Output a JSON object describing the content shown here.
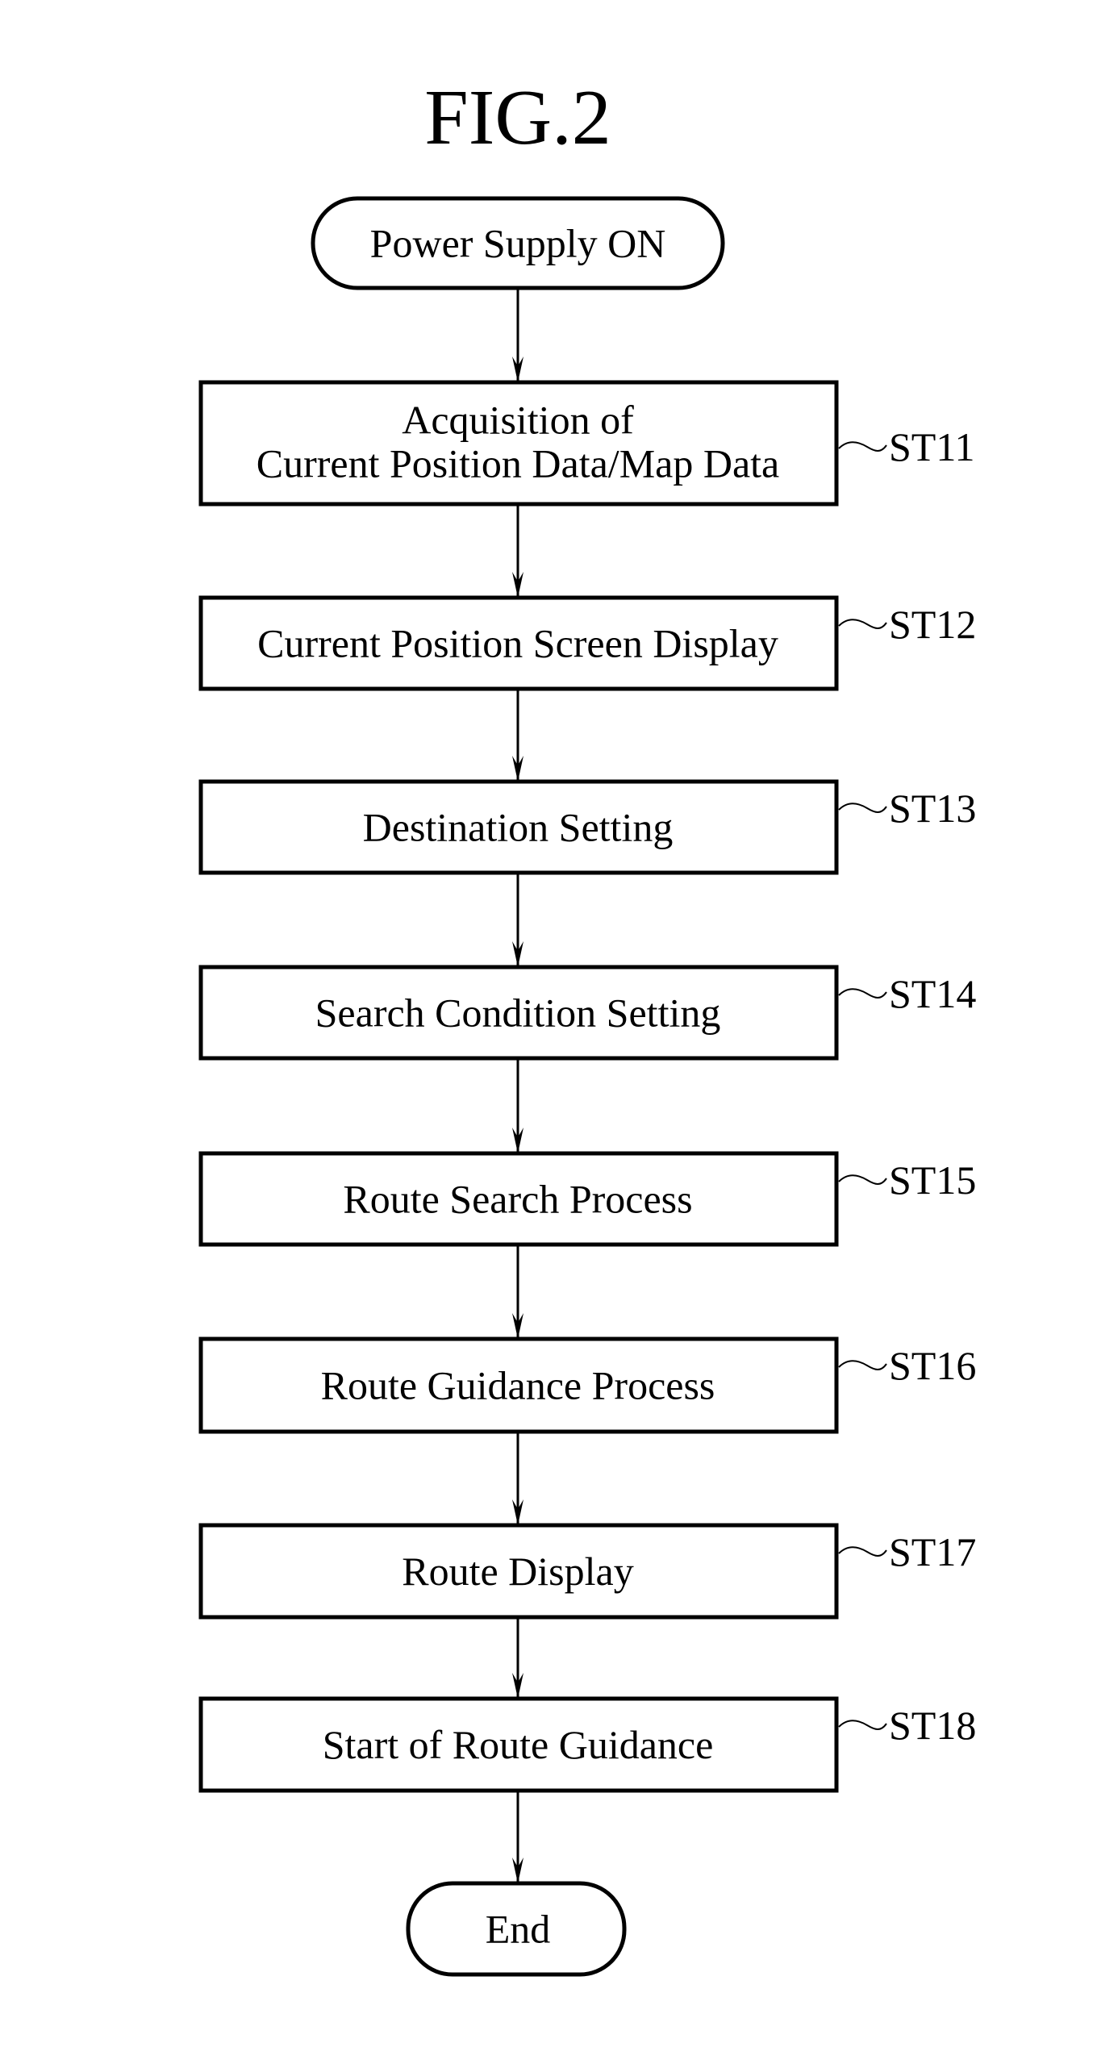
{
  "figure": {
    "title": "FIG.2",
    "start": {
      "label": "Power Supply ON"
    },
    "steps": [
      {
        "id": "ST11",
        "lines": [
          "Acquisition of",
          "Current Position Data/Map Data"
        ]
      },
      {
        "id": "ST12",
        "lines": [
          "Current Position Screen Display"
        ]
      },
      {
        "id": "ST13",
        "lines": [
          "Destination Setting"
        ]
      },
      {
        "id": "ST14",
        "lines": [
          "Search Condition Setting"
        ]
      },
      {
        "id": "ST15",
        "lines": [
          "Route Search Process"
        ]
      },
      {
        "id": "ST16",
        "lines": [
          "Route Guidance Process"
        ]
      },
      {
        "id": "ST17",
        "lines": [
          "Route Display"
        ]
      },
      {
        "id": "ST18",
        "lines": [
          "Start of Route Guidance"
        ]
      }
    ],
    "end": {
      "label": "End"
    },
    "colors": {
      "stroke": "#000000",
      "background": "#ffffff"
    }
  }
}
